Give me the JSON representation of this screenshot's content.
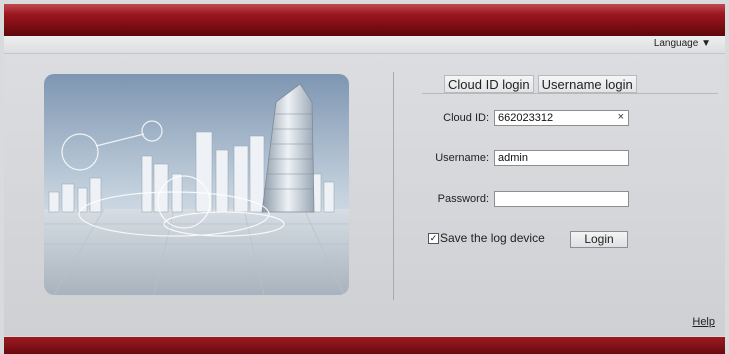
{
  "header": {
    "language_label": "Language",
    "language_arrow": "▼"
  },
  "tabs": [
    {
      "label": "Cloud ID login"
    },
    {
      "label": "Username login"
    }
  ],
  "form": {
    "cloud_id": {
      "label": "Cloud ID:",
      "value": "662023312",
      "clear_glyph": "×"
    },
    "username": {
      "label": "Username:",
      "value": "admin"
    },
    "password": {
      "label": "Password:",
      "value": ""
    },
    "remember": {
      "label": "Save the log device",
      "checked": true,
      "check_glyph": "✓"
    },
    "login_button": "Login"
  },
  "footer": {
    "help_link": "Help"
  },
  "colors": {
    "brand_red": "#8a1017",
    "panel_bg": "#d9dadc"
  },
  "icons": {
    "language": "caret-down-icon",
    "clear": "close-icon",
    "remember": "checkbox-checked-icon"
  }
}
